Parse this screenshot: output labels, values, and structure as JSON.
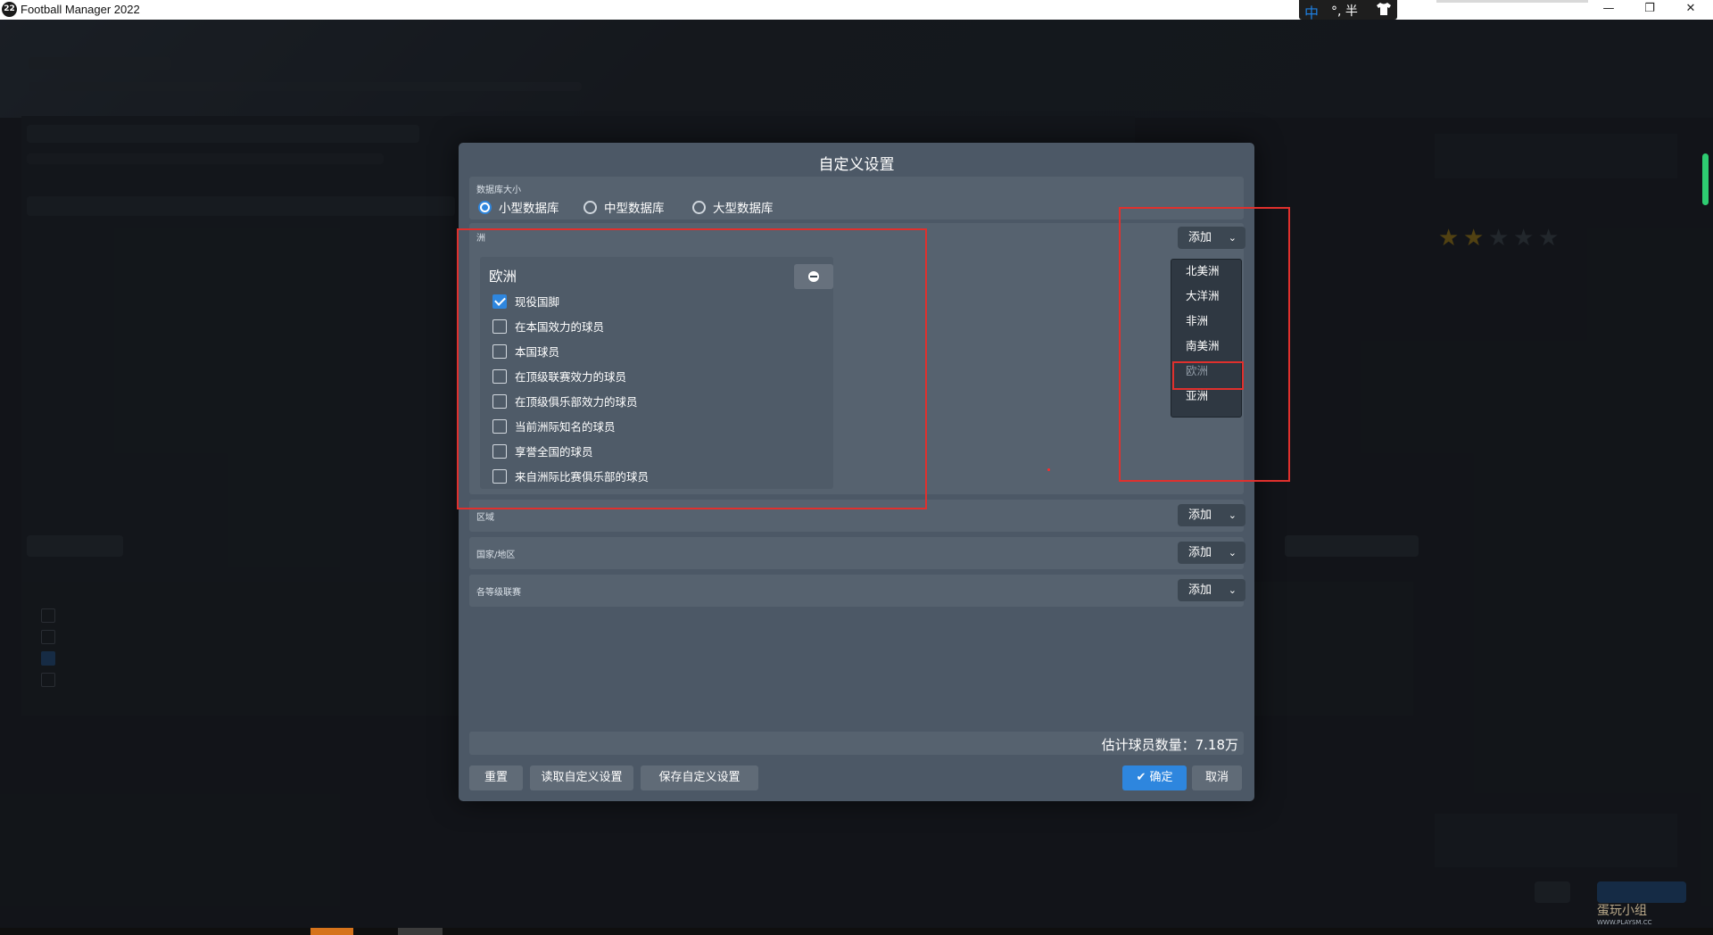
{
  "window": {
    "app_icon_text": "22",
    "title": "Football Manager 2022",
    "ime": {
      "mode": "中",
      "rest": "°, 半"
    },
    "controls": {
      "minimize": "—",
      "restore": "❐",
      "close": "✕"
    }
  },
  "modal": {
    "title": "自定义设置",
    "database_size": {
      "label": "数据库大小",
      "options": [
        "小型数据库",
        "中型数据库",
        "大型数据库"
      ],
      "selected": "小型数据库"
    },
    "continent": {
      "label": "洲",
      "add_label": "添加",
      "selected_card": {
        "title": "欧洲",
        "options": [
          {
            "label": "现役国脚",
            "checked": true
          },
          {
            "label": "在本国效力的球员",
            "checked": false
          },
          {
            "label": "本国球员",
            "checked": false
          },
          {
            "label": "在顶级联赛效力的球员",
            "checked": false
          },
          {
            "label": "在顶级俱乐部效力的球员",
            "checked": false
          },
          {
            "label": "当前洲际知名的球员",
            "checked": false
          },
          {
            "label": "享誉全国的球员",
            "checked": false
          },
          {
            "label": "来自洲际比赛俱乐部的球员",
            "checked": false
          }
        ]
      },
      "dropdown_items": [
        {
          "label": "北美洲",
          "disabled": false
        },
        {
          "label": "大洋洲",
          "disabled": false
        },
        {
          "label": "非洲",
          "disabled": false
        },
        {
          "label": "南美洲",
          "disabled": false
        },
        {
          "label": "欧洲",
          "disabled": true
        },
        {
          "label": "亚洲",
          "disabled": false
        }
      ]
    },
    "region": {
      "label": "区域",
      "add_label": "添加"
    },
    "nation": {
      "label": "国家/地区",
      "add_label": "添加"
    },
    "leagues": {
      "label": "各等级联赛",
      "add_label": "添加"
    },
    "estimate": "估计球员数量：7.18万",
    "buttons": {
      "reset": "重置",
      "load": "读取自定义设置",
      "save": "保存自定义设置",
      "ok": "确定",
      "cancel": "取消"
    }
  },
  "watermark": {
    "text": "蛋玩小组",
    "url": "WWW.PLAYSM.CC"
  },
  "colors": {
    "accent": "#2e86de",
    "highlight": "#e0302d",
    "modal_bg": "#4c5866"
  }
}
